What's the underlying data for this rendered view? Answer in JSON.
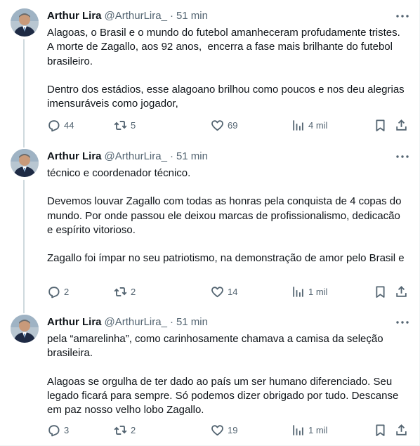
{
  "tweets": [
    {
      "name": "Arthur Lira",
      "handle": "@ArthurLira_",
      "separator": "·",
      "time": "51 min",
      "paragraphs": [
        "Alagoas, o Brasil e o mundo do futebol amanheceram profudamente tristes. A morte de Zagallo, aos 92 anos,  encerra a fase mais brilhante do futebol brasileiro.",
        "Dentro dos estádios, esse alagoano brilhou como poucos e nos deu alegrias imensuráveis como jogador,"
      ],
      "replies": "44",
      "retweets": "5",
      "likes": "69",
      "views": "4 mil"
    },
    {
      "name": "Arthur Lira",
      "handle": "@ArthurLira_",
      "separator": "·",
      "time": "51 min",
      "paragraphs": [
        "técnico e coordenador técnico.",
        "Devemos louvar Zagallo com todas as honras pela conquista de 4 copas do mundo. Por onde passou ele deixou marcas de profissionalismo, dedicacão e espírito vitorioso.",
        "Zagallo foi ímpar no seu patriotismo, na demonstração de amor pelo Brasil e"
      ],
      "replies": "2",
      "retweets": "2",
      "likes": "14",
      "views": "1 mil"
    },
    {
      "name": "Arthur Lira",
      "handle": "@ArthurLira_",
      "separator": "·",
      "time": "51 min",
      "paragraphs": [
        "pela “amarelinha”, como carinhosamente chamava a camisa da seleção brasileira.",
        "Alagoas se orgulha de ter dado ao país um ser humano diferenciado. Seu legado ficará para sempre. Só podemos dizer obrigado por tudo. Descanse em paz nosso velho lobo Zagallo."
      ],
      "replies": "3",
      "retweets": "2",
      "likes": "19",
      "views": "1 mil"
    }
  ],
  "icons": {
    "reply": "reply-icon",
    "retweet": "retweet-icon",
    "like": "heart-icon",
    "views": "views-chart-icon",
    "bookmark": "bookmark-icon",
    "share": "share-icon",
    "more": "more-dots-icon"
  },
  "colors": {
    "text": "#0f1419",
    "secondary": "#536471",
    "thread_line": "#cfd9de"
  }
}
